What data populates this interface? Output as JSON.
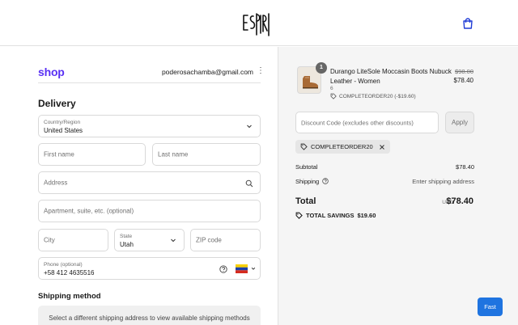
{
  "header": {
    "logo_alt": "ESPIRITU",
    "cart_icon": "shopping-bag-icon"
  },
  "account": {
    "brand": "shop",
    "email": "poderosachamba@gmail.com",
    "menu_icon": "kebab-icon"
  },
  "delivery": {
    "heading": "Delivery",
    "country": {
      "label": "Country/Region",
      "value": "United States"
    },
    "first_name": {
      "placeholder": "First name"
    },
    "last_name": {
      "placeholder": "Last name"
    },
    "address": {
      "placeholder": "Address"
    },
    "apartment": {
      "placeholder": "Apartment, suite, etc. (optional)"
    },
    "city": {
      "placeholder": "City"
    },
    "state": {
      "label": "State",
      "value": "Utah"
    },
    "zip": {
      "placeholder": "ZIP code"
    },
    "phone": {
      "label": "Phone (optional)",
      "value": "+58 412 4635516"
    }
  },
  "shipping": {
    "heading": "Shipping method",
    "message": "Select a different shipping address to view available shipping methods"
  },
  "order": {
    "item": {
      "quantity": "1",
      "name": "Durango LiteSole Moccasin Boots Nubuck Leather - Women",
      "variant": "6",
      "discount": "COMPLETEORDER20 (-$19.60)",
      "price_old": "$98.00",
      "price_new": "$78.40"
    },
    "discount_placeholder": "Discount Code (excludes other discounts)",
    "apply_label": "Apply",
    "applied_code": "COMPLETEORDER20",
    "subtotal_label": "Subtotal",
    "subtotal_value": "$78.40",
    "shipping_label": "Shipping",
    "shipping_value": "Enter shipping address",
    "total_label": "Total",
    "total_currency": "USD",
    "total_value": "$78.40",
    "savings_label": "TOTAL SAVINGS",
    "savings_value": "$19.60"
  },
  "fast_label": "Fast",
  "colors": {
    "shop_brand": "#5a31f4",
    "fast_button": "#1f74e0",
    "summary_bg": "#f5f5f5"
  }
}
